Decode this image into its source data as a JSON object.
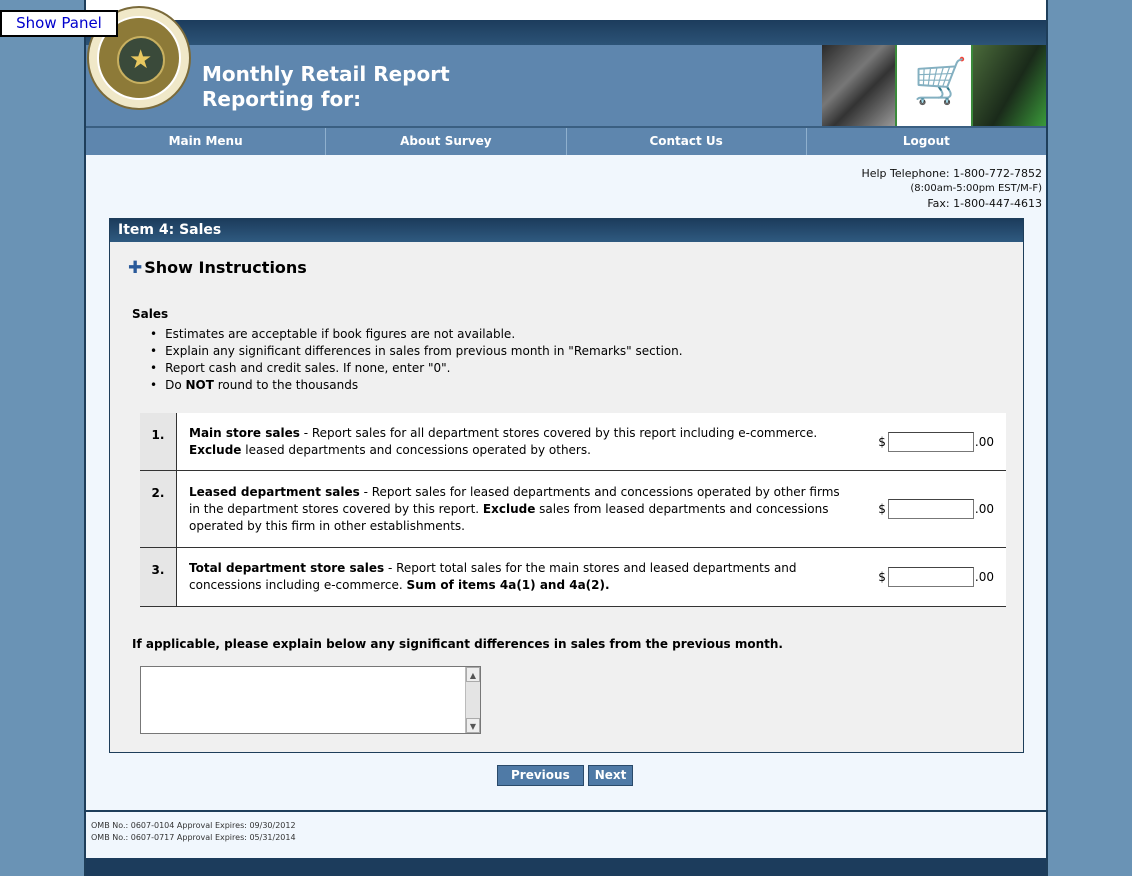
{
  "show_panel": "Show Panel",
  "header": {
    "title_line1": "Monthly Retail Report",
    "title_line2": "Reporting for:"
  },
  "nav": [
    "Main Menu",
    "About Survey",
    "Contact Us",
    "Logout"
  ],
  "help": {
    "telephone": "Help Telephone: 1-800-772-7852",
    "hours": "(8:00am-5:00pm EST/M-F)",
    "fax": "Fax: 1-800-447-4613"
  },
  "panel": {
    "title": "Item 4: Sales",
    "show_instructions": "Show Instructions",
    "sales_heading": "Sales",
    "bullets": [
      "Estimates are acceptable if book figures are not available.",
      "Explain any significant differences in sales from previous month in \"Remarks\" section.",
      "Report cash and credit sales. If none, enter \"0\".",
      "Do NOT round to the thousands"
    ],
    "items": [
      {
        "num": "1.",
        "label": "Main store sales",
        "desc": " - Report sales for all department stores covered by this report including e-commerce. ",
        "bold2": "Exclude",
        "desc2": " leased departments and concessions operated by others.",
        "value": ""
      },
      {
        "num": "2.",
        "label": "Leased department sales",
        "desc": " - Report sales for leased departments and concessions operated by other firms in the department stores covered by this report. ",
        "bold2": "Exclude",
        "desc2": " sales from leased departments and concessions operated by this firm in other establishments.",
        "value": ""
      },
      {
        "num": "3.",
        "label": "Total department store sales",
        "desc": " - Report total sales for the main stores and leased departments and concessions including e-commerce. ",
        "bold2": "Sum of items 4a(1) and 4a(2).",
        "desc2": "",
        "value": ""
      }
    ],
    "currency": "$",
    "cents": ".00",
    "explain_label": "If applicable, please explain below any significant differences in sales from the previous month.",
    "remarks_value": ""
  },
  "buttons": {
    "previous": "Previous",
    "next": "Next"
  },
  "omb": [
    "OMB No.: 0607-0104 Approval Expires: 09/30/2012",
    "OMB No.: 0607-0717 Approval Expires: 05/31/2014"
  ]
}
